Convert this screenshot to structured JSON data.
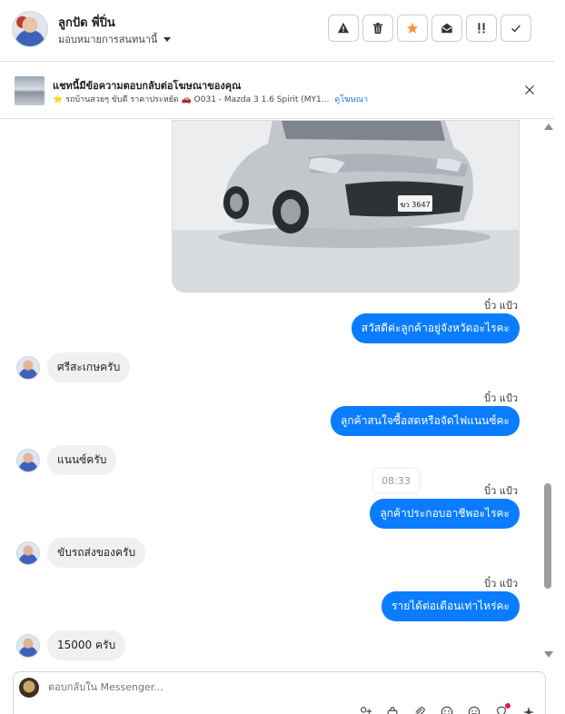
{
  "header": {
    "contact_name": "ลูกปัด พี่ปิ่น",
    "assign_label": "มอบหมายการสนทนานี้",
    "toolbar": [
      {
        "name": "warning-button",
        "icon": "warning-icon"
      },
      {
        "name": "delete-button",
        "icon": "trash-icon"
      },
      {
        "name": "star-button",
        "icon": "star-icon",
        "color": "#f7923a"
      },
      {
        "name": "mark-unread-button",
        "icon": "envelope-open-icon"
      },
      {
        "name": "priority-button",
        "icon": "exclamation-icon"
      },
      {
        "name": "done-button",
        "icon": "check-icon"
      }
    ]
  },
  "ad_banner": {
    "title": "แชทนี้มีข้อความตอบกลับต่อโฆษณาของคุณ",
    "subtitle": "⭐ รถบ้านสวยๆ ขับดี ราคาประหยัด 🚗 O031 - Mazda 3 1.6 Spirit (MY1...",
    "link": "ดูโฆษณา"
  },
  "messages": [
    {
      "type": "out",
      "sender": "บิ๋ว แป้ว",
      "text": "สวัสดีค่ะลูกค้าอยู่จังหวัดอะไรคะ"
    },
    {
      "type": "in",
      "text": "ศรีสะเกษครับ"
    },
    {
      "type": "out",
      "sender": "บิ๋ว แป้ว",
      "text": "ลูกค้าสนใจซื้อสดหรือจัดไฟแนนซ์คะ"
    },
    {
      "type": "in",
      "text": "แนนซ์ครับ"
    },
    {
      "type": "out",
      "sender": "บิ๋ว แป้ว",
      "text": "ลูกค้าประกอบอาชีพอะไรคะ"
    },
    {
      "type": "in",
      "text": "ขับรถส่งของครับ"
    },
    {
      "type": "out",
      "sender": "บิ๋ว แป้ว",
      "text": "รายได้ต่อเดือนเท่าไหร่คะ"
    },
    {
      "type": "in",
      "text": "15000 ครับ"
    }
  ],
  "timestamp": "08:33",
  "composer": {
    "placeholder": "ตอบกลับใน Messenger...",
    "tools": [
      "add-person-icon",
      "bag-icon",
      "attach-icon",
      "emoji-icon",
      "sticker-icon",
      "bulb-icon",
      "sparkle-icon"
    ]
  },
  "colors": {
    "outgoing_bubble": "#0a7cff",
    "incoming_bubble": "#f0f0f0",
    "link": "#1877f2"
  }
}
